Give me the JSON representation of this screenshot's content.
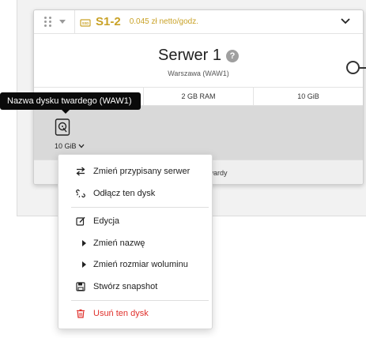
{
  "card": {
    "server_name": "S1-2",
    "price": "0.045 zł netto/godz.",
    "title": "Serwer 1",
    "help_glyph": "?",
    "location": "Warszawa (WAW1)",
    "specs": [
      "",
      "2 GB RAM",
      "10 GiB"
    ],
    "disk_size": "10 GiB",
    "footer_text": "k twardy"
  },
  "tooltip": {
    "text": "Nazwa dysku twardego (WAW1)"
  },
  "menu": {
    "items": [
      {
        "label": "Zmień przypisany serwer",
        "icon": "swap-arrows-icon"
      },
      {
        "label": "Odłącz ten dysk",
        "icon": "unlink-icon"
      },
      {
        "label": "Edycja",
        "icon": "edit-icon"
      },
      {
        "label": "Zmień nazwę",
        "icon": "submenu-triangle-icon"
      },
      {
        "label": "Zmień rozmiar woluminu",
        "icon": "submenu-triangle-icon"
      },
      {
        "label": "Stwórz snapshot",
        "icon": "save-icon"
      },
      {
        "label": "Usuń ten dysk",
        "icon": "trash-icon"
      }
    ]
  },
  "colors": {
    "accent": "#c9a227",
    "danger": "#e0312c",
    "tooltip_bg": "#0a0a0a",
    "disk_area_bg": "#d9d9d9"
  }
}
